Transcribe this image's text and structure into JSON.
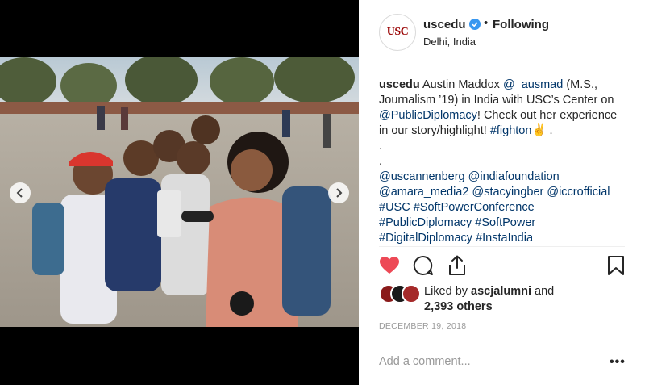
{
  "post": {
    "username": "uscedu",
    "avatar_logo": "USC",
    "bullet": "•",
    "follow_status": "Following",
    "location": "Delhi, India",
    "caption": {
      "username": "uscedu",
      "text_1": " Austin Maddox ",
      "mention_1": "@_ausmad",
      "text_2": " (M.S., Journalism ’19) in India with USC’s Center on ",
      "mention_2": "@PublicDiplomacy",
      "text_3": "! Check out her experience in our story/highlight! ",
      "hashtag_1": "#fighton",
      "emoji": "✌",
      "text_4": " .",
      "dot_1": ".",
      "dot_2": ".",
      "tags_line_1": "@uscannenberg @indiafoundation",
      "tags_line_2": "@amara_media2 @stacyingber @iccrofficial",
      "tags_line_3": "#USC #SoftPowerConference",
      "tags_line_4": "#PublicDiplomacy #SoftPower",
      "tags_line_5": "#DigitalDiplomacy #InstaIndia"
    },
    "liked_by_prefix": "Liked by ",
    "liked_by_user": "ascjalumni",
    "liked_by_and": " and",
    "likes_others": "2,393 others",
    "date": "DECEMBER 19, 2018",
    "comment_placeholder": "Add a comment...",
    "more_label": "•••"
  },
  "carousel": {
    "slides": 4,
    "active_index": 0
  },
  "colors": {
    "like_red": "#ed4956",
    "link_blue": "#003569",
    "verified_blue": "#3897f0",
    "usc_cardinal": "#990000"
  },
  "icons": [
    "chevron-left-icon",
    "chevron-right-icon",
    "heart-icon",
    "comment-icon",
    "share-icon",
    "bookmark-icon",
    "verified-badge-icon"
  ]
}
